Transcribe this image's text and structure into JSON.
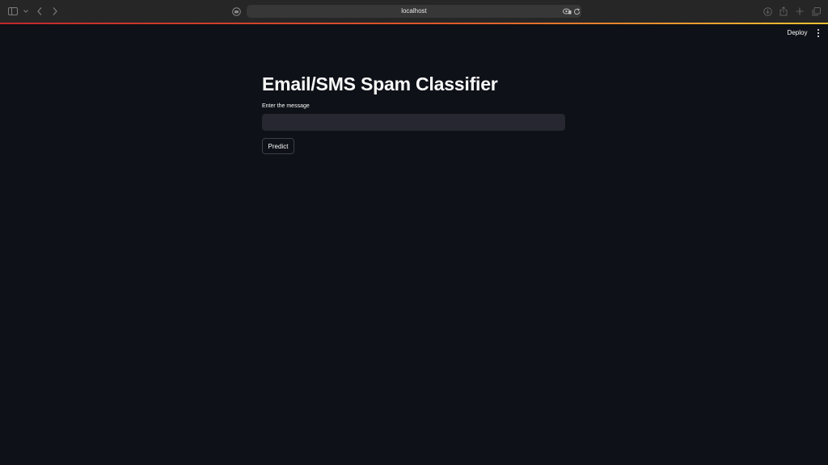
{
  "browser": {
    "url": "localhost",
    "icons": {
      "sidebar": "sidebar-icon",
      "sidebar_menu": "chevron-down-icon",
      "back": "chevron-left-icon",
      "forward": "chevron-right-icon",
      "site": "site-settings-icon",
      "privacy": "privacy-report-icon",
      "reload": "reload-icon",
      "downloads": "download-icon",
      "share": "share-icon",
      "new_tab": "plus-icon",
      "tab_overview": "tabs-icon"
    },
    "accent_colors": [
      "#c2272d",
      "#e05a2b",
      "#f1c232"
    ]
  },
  "header": {
    "deploy_label": "Deploy",
    "menu_icon": "kebab-menu-icon"
  },
  "main": {
    "title": "Email/SMS Spam Classifier",
    "input_label": "Enter the message",
    "input_value": "",
    "button_label": "Predict"
  },
  "theme": {
    "background": "#0e1117",
    "input_background": "#262730",
    "text": "#fafafa"
  }
}
